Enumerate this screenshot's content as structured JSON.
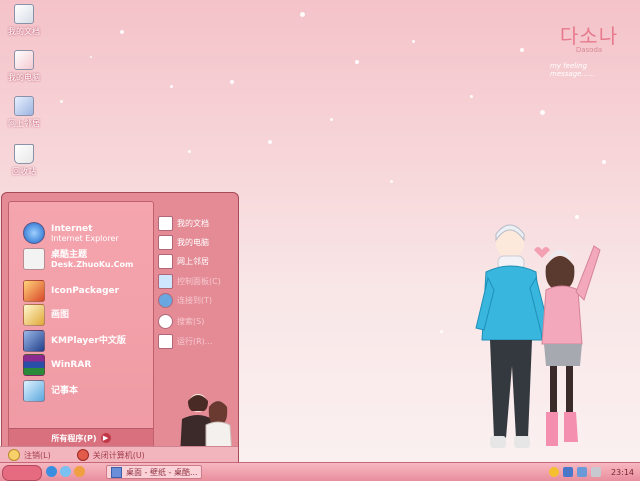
{
  "desktop": {
    "icons": [
      {
        "label": "我的文档",
        "icon": "my-documents-icon"
      },
      {
        "label": "我的电脑",
        "icon": "my-computer-icon"
      },
      {
        "label": "网上邻居",
        "icon": "network-places-icon"
      },
      {
        "label": "回收站",
        "icon": "recycle-bin-icon"
      }
    ],
    "logo": {
      "korean": "다소나",
      "sub": "Dasoda",
      "message": "my feeling message......"
    }
  },
  "start_menu": {
    "pinned": [
      {
        "title": "Internet",
        "subtitle": "Internet Explorer",
        "icon": "internet-explorer-icon"
      },
      {
        "title": "桌酷主题",
        "subtitle": "Desk.ZhuoKu.Com",
        "icon": "zhuoku-theme-icon"
      }
    ],
    "programs": [
      {
        "title": "IconPackager",
        "icon": "iconpackager-icon"
      },
      {
        "title": "画图",
        "icon": "paint-icon"
      },
      {
        "title": "KMPlayer中文版",
        "icon": "kmplayer-icon"
      },
      {
        "title": "WinRAR",
        "icon": "winrar-icon"
      },
      {
        "title": "记事本",
        "icon": "notepad-icon"
      }
    ],
    "all_programs": "所有程序(P)",
    "right": [
      {
        "label": "我的文档",
        "dim": false
      },
      {
        "label": "我的电脑",
        "dim": false
      },
      {
        "label": "网上邻居",
        "dim": false
      },
      {
        "label": "控制面板(C)",
        "dim": true
      },
      {
        "label": "连接到(T)",
        "dim": true
      },
      {
        "label": "搜索(S)",
        "dim": true
      },
      {
        "label": "运行(R)...",
        "dim": true
      }
    ],
    "logoff": "注销(L)",
    "shutdown": "关闭计算机(U)"
  },
  "taskbar": {
    "task": "桌面 - 壁纸 - 桌酷...",
    "clock": "23:14"
  },
  "colors": {
    "accent": "#e48b96",
    "taskbar": "#e98e9c",
    "text_dark": "#7a2434"
  }
}
